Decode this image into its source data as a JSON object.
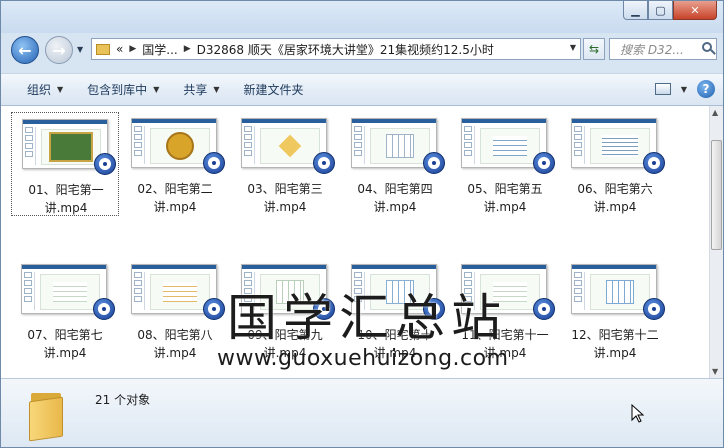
{
  "window": {
    "caption_buttons": [
      "minimize-icon",
      "maximize-icon",
      "close-icon"
    ]
  },
  "address": {
    "overflow": "«",
    "segments": [
      "国学...",
      "D32868 顺天《居家环境大讲堂》21集视频约12.5小时"
    ],
    "search_placeholder": "搜索 D32..."
  },
  "toolbar": {
    "organize": "组织",
    "include_library": "包含到库中",
    "share": "共享",
    "new_folder": "新建文件夹"
  },
  "files": [
    {
      "label": "01、阳宅第一讲.mp4"
    },
    {
      "label": "02、阳宅第二讲.mp4"
    },
    {
      "label": "03、阳宅第三讲.mp4"
    },
    {
      "label": "04、阳宅第四讲.mp4"
    },
    {
      "label": "05、阳宅第五讲.mp4"
    },
    {
      "label": "06、阳宅第六讲.mp4"
    },
    {
      "label": "07、阳宅第七讲.mp4"
    },
    {
      "label": "08、阳宅第八讲.mp4"
    },
    {
      "label": "09、阳宅第九讲.mp4"
    },
    {
      "label": "10、阳宅第十讲.mp4"
    },
    {
      "label": "11、阳宅第十一讲.mp4"
    },
    {
      "label": "12、阳宅第十二讲.mp4"
    }
  ],
  "watermark": {
    "title": "国学汇总站",
    "url": "www.guoxuehuizong.com"
  },
  "details": {
    "count": "21 个对象"
  },
  "colors": {
    "toolbar_text": "#1e3a5c",
    "video_badge": "#1a3f93",
    "slide_header": "#2a5f9e"
  }
}
